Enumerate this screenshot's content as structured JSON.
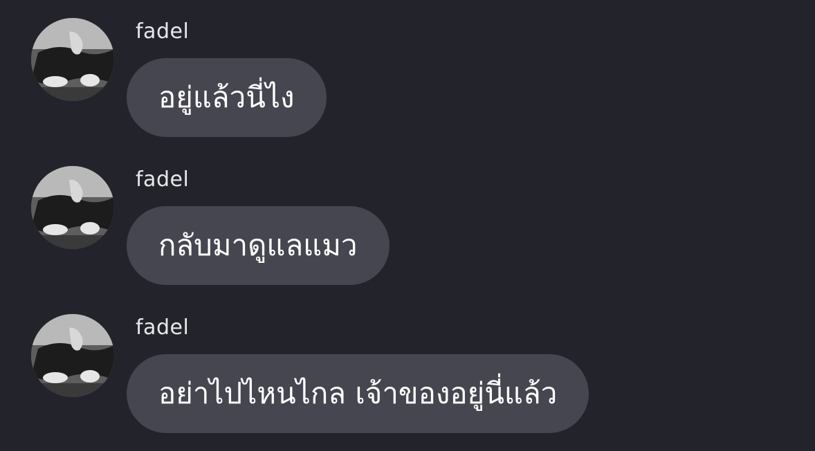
{
  "chat": {
    "background": "#23232b",
    "bubble_color": "#464650",
    "messages": [
      {
        "sender": "fadel",
        "avatar_icon": "user-avatar-icon",
        "text": "อยู่แล้วนี่ไง"
      },
      {
        "sender": "fadel",
        "avatar_icon": "user-avatar-icon",
        "text": "กลับมาดูแลแมว"
      },
      {
        "sender": "fadel",
        "avatar_icon": "user-avatar-icon",
        "text": "อย่าไปไหนไกล เจ้าของอยู่นี่แล้ว"
      }
    ]
  }
}
